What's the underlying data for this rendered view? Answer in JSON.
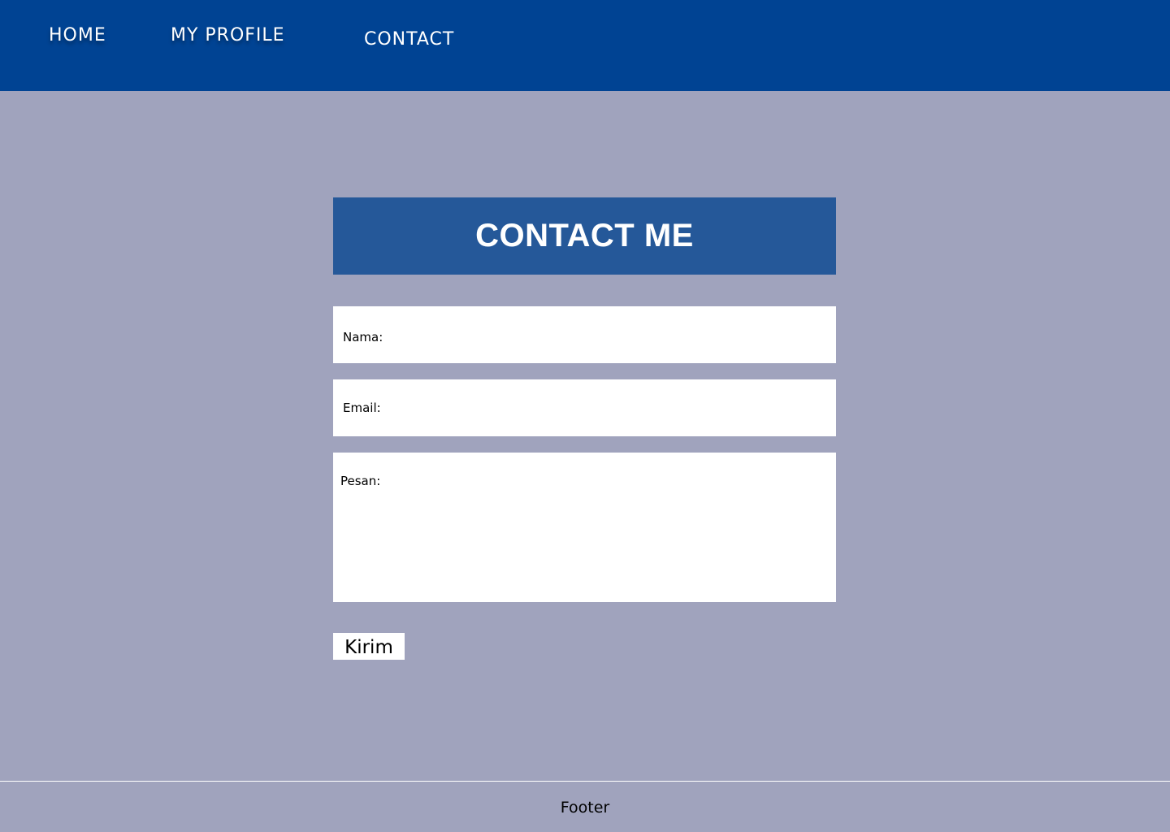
{
  "nav": {
    "items": [
      {
        "label": "HOME"
      },
      {
        "label": "MY PROFILE"
      },
      {
        "label": "CONTACT"
      }
    ]
  },
  "main": {
    "title": "CONTACT ME",
    "form": {
      "name_label": "Nama:",
      "email_label": "Email:",
      "message_label": "Pesan:",
      "submit_label": "Kirim"
    }
  },
  "footer": {
    "text": "Footer"
  },
  "colors": {
    "navbar": "#004393",
    "page_background": "#a0a3bd",
    "title_box": "#255899",
    "field_background": "#ffffff"
  }
}
